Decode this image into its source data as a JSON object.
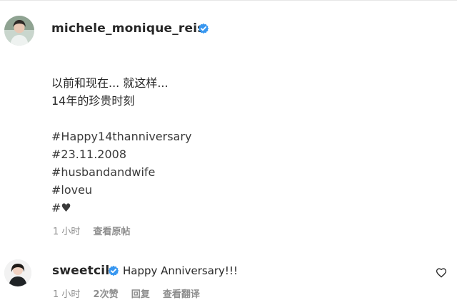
{
  "post": {
    "username": "michele_monique_reis",
    "caption_lines": [
      "以前和现在... 就这样...",
      "14年的珍贵时刻",
      "",
      "#Happy14thanniversary",
      "#23.11.2008",
      "#husbandandwife",
      "#loveu",
      "#♥"
    ],
    "meta": {
      "time": "1 小时",
      "see_original": "查看原帖"
    }
  },
  "comment": {
    "username": "sweetcil",
    "text": "Happy Anniversary!!!",
    "meta": {
      "time": "1 小时",
      "likes": "2次赞",
      "reply": "回复",
      "translate": "查看翻译"
    }
  },
  "colors": {
    "verified_blue": "#3897f0",
    "meta_gray": "#8e8e8e",
    "text_dark": "#262626"
  },
  "icons": {
    "verified": "verified-badge-icon",
    "like": "heart-outline-icon"
  }
}
